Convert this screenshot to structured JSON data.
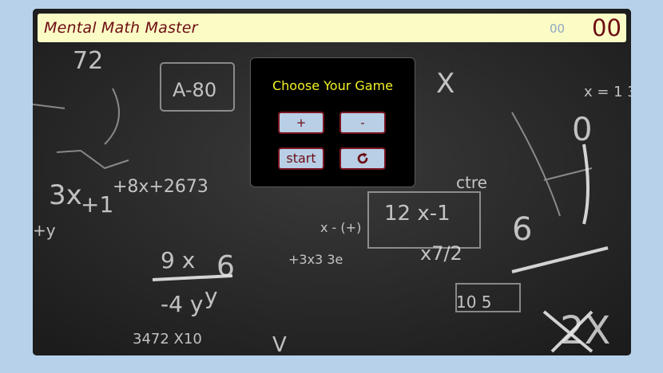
{
  "header": {
    "title": "Mental Math Master",
    "small_score": "00",
    "big_score": "00"
  },
  "menu": {
    "heading": "Choose Your Game",
    "plus_label": "+",
    "minus_label": "-",
    "start_label": "start",
    "refresh_icon": "refresh-icon"
  },
  "colors": {
    "page_background": "#b7d1ea",
    "header_background": "#fbfbc6",
    "title_color": "#6d0c12",
    "heading_color": "#f2f226",
    "button_background": "#b8cfe6",
    "button_border": "#7a1520"
  }
}
